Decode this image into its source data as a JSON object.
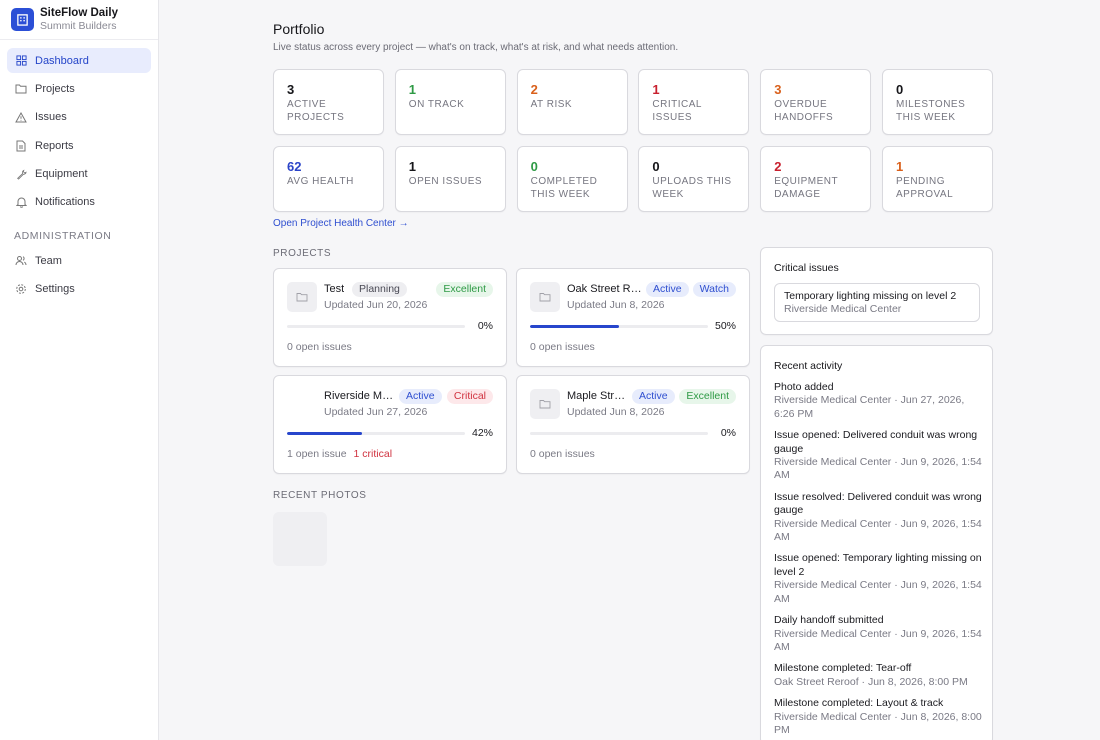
{
  "brand": {
    "name": "SiteFlow Daily",
    "org": "Summit Builders"
  },
  "nav": [
    {
      "label": "Dashboard",
      "icon": "grid-icon",
      "active": true
    },
    {
      "label": "Projects",
      "icon": "folder-icon"
    },
    {
      "label": "Issues",
      "icon": "warning-icon"
    },
    {
      "label": "Reports",
      "icon": "document-icon"
    },
    {
      "label": "Equipment",
      "icon": "wrench-icon"
    },
    {
      "label": "Notifications",
      "icon": "bell-icon"
    }
  ],
  "admin": {
    "label": "ADMINISTRATION",
    "items": [
      {
        "label": "Team",
        "icon": "users-icon"
      },
      {
        "label": "Settings",
        "icon": "gear-icon"
      }
    ]
  },
  "page": {
    "title": "Portfolio",
    "subtitle": "Live status across every project — what's on track, what's at risk, and what needs attention."
  },
  "stats": [
    {
      "value": "3",
      "label": "ACTIVE PROJECTS",
      "color": "#16161a"
    },
    {
      "value": "1",
      "label": "ON TRACK",
      "color": "#2e9a45"
    },
    {
      "value": "2",
      "label": "AT RISK",
      "color": "#d9601b"
    },
    {
      "value": "1",
      "label": "CRITICAL ISSUES",
      "color": "#c8202e"
    },
    {
      "value": "3",
      "label": "OVERDUE HANDOFFS",
      "color": "#d9601b"
    },
    {
      "value": "0",
      "label": "MILESTONES THIS WEEK",
      "color": "#16161a"
    },
    {
      "value": "62",
      "label": "AVG HEALTH",
      "color": "#2b44c8"
    },
    {
      "value": "1",
      "label": "OPEN ISSUES",
      "color": "#16161a"
    },
    {
      "value": "0",
      "label": "COMPLETED THIS WEEK",
      "color": "#2e9a45"
    },
    {
      "value": "0",
      "label": "UPLOADS THIS WEEK",
      "color": "#16161a"
    },
    {
      "value": "2",
      "label": "EQUIPMENT DAMAGE",
      "color": "#c8202e"
    },
    {
      "value": "1",
      "label": "PENDING APPROVAL",
      "color": "#d9601b"
    }
  ],
  "health_link": "Open Project Health Center →",
  "projects_label": "PROJECTS",
  "projects": [
    {
      "name": "Test",
      "updated": "Updated Jun 20, 2026",
      "status": "Planning",
      "status_style": "gray",
      "health": "Excellent",
      "health_style": "green",
      "progress": 0,
      "progress_text": "0%",
      "issues": "0 open issues",
      "critical": "",
      "thumb": true
    },
    {
      "name": "Oak Street Re...",
      "updated": "Updated Jun 8, 2026",
      "status": "Active",
      "status_style": "blue",
      "health": "Watch",
      "health_style": "blue",
      "progress": 50,
      "progress_text": "50%",
      "issues": "0 open issues",
      "critical": "",
      "thumb": true
    },
    {
      "name": "Riverside Me...",
      "updated": "Updated Jun 27, 2026",
      "status": "Active",
      "status_style": "blue",
      "health": "Critical",
      "health_style": "red",
      "progress": 42,
      "progress_text": "42%",
      "issues": "1 open issue",
      "critical": "1 critical",
      "thumb": false
    },
    {
      "name": "Maple Stre...",
      "updated": "Updated Jun 8, 2026",
      "status": "Active",
      "status_style": "blue",
      "health": "Excellent",
      "health_style": "green",
      "progress": 0,
      "progress_text": "0%",
      "issues": "0 open issues",
      "critical": "",
      "thumb": true
    }
  ],
  "photos_label": "RECENT PHOTOS",
  "critical": {
    "title": "Critical issues",
    "items": [
      {
        "title": "Temporary lighting missing on level 2",
        "project": "Riverside Medical Center"
      }
    ]
  },
  "activity": {
    "title": "Recent activity",
    "items": [
      {
        "title": "Photo added",
        "meta": "Riverside Medical Center · Jun 27, 2026, 6:26 PM"
      },
      {
        "title": "Issue opened: Delivered conduit was wrong gauge",
        "meta": "Riverside Medical Center · Jun 9, 2026, 1:54 AM"
      },
      {
        "title": "Issue resolved: Delivered conduit was wrong gauge",
        "meta": "Riverside Medical Center · Jun 9, 2026, 1:54 AM"
      },
      {
        "title": "Issue opened: Temporary lighting missing on level 2",
        "meta": "Riverside Medical Center · Jun 9, 2026, 1:54 AM"
      },
      {
        "title": "Daily handoff submitted",
        "meta": "Riverside Medical Center · Jun 9, 2026, 1:54 AM"
      },
      {
        "title": "Milestone completed: Tear-off",
        "meta": "Oak Street Reroof · Jun 8, 2026, 8:00 PM"
      },
      {
        "title": "Milestone completed: Layout & track",
        "meta": "Riverside Medical Center · Jun 8, 2026, 8:00 PM"
      }
    ]
  }
}
